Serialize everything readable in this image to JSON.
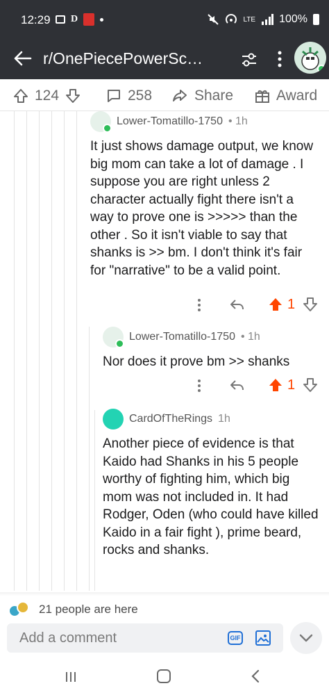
{
  "status_bar": {
    "time": "12:29",
    "carrier_mark": "D",
    "signal_text": "LTE",
    "battery": "100%"
  },
  "app_bar": {
    "title": "r/OnePiecePowerSc…"
  },
  "post_actions": {
    "upvotes": "124",
    "comments": "258",
    "share_label": "Share",
    "award_label": "Award"
  },
  "comments": [
    {
      "user": "Lower-Tomatillo-1750",
      "time": "1h",
      "body": "It just shows damage output, we know big mom can take a lot of damage . I suppose you are right unless 2 character actually fight there isn't a way to prove one is >>>>> than the other . So it isn't viable to say that shanks is >> bm. I don't think it's fair for \"narrative\" to be a valid point.",
      "score": "1"
    },
    {
      "user": "Lower-Tomatillo-1750",
      "time": "1h",
      "body": "Nor does it prove bm >> shanks",
      "score": "1"
    },
    {
      "user": "CardOfTheRings",
      "time": "1h",
      "body": "Another piece of evidence is that Kaido had Shanks in his 5 people worthy of fighting him, which big mom was not included in. It had Rodger, Oden (who could have killed Kaido in a fair fight ), prime beard, rocks and shanks."
    }
  ],
  "presence": {
    "text": "21 people are here"
  },
  "composer": {
    "placeholder": "Add a comment",
    "gif_label": "GIF"
  },
  "colors": {
    "upvote_active": "#ff4500",
    "header_bg": "#2f3136",
    "online_dot": "#2ebd59",
    "accent_blue": "#1f6fd6"
  }
}
